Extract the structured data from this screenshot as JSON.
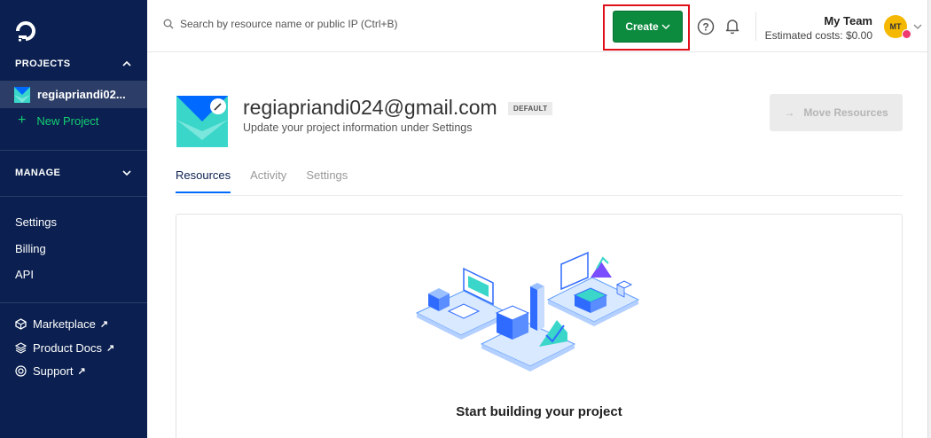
{
  "sidebar": {
    "projects_heading": "PROJECTS",
    "current_project": "regiapriandi02...",
    "new_project": "New Project",
    "manage_heading": "MANAGE",
    "nav": {
      "settings": "Settings",
      "billing": "Billing",
      "api": "API"
    },
    "external": {
      "marketplace": "Marketplace",
      "docs": "Product Docs",
      "support": "Support"
    },
    "arrow_glyph": "↗"
  },
  "topbar": {
    "search_placeholder": "Search by resource name or public IP (Ctrl+B)",
    "create_label": "Create",
    "team_name": "My Team",
    "estimated_costs": "Estimated costs: $0.00",
    "avatar_initials": "MT"
  },
  "project": {
    "title": "regiapriandi024@gmail.com",
    "badge": "DEFAULT",
    "subtitle": "Update your project information under Settings",
    "move_resources": "Move Resources"
  },
  "tabs": {
    "resources": "Resources",
    "activity": "Activity",
    "settings": "Settings"
  },
  "empty_state": {
    "title": "Start building your project"
  },
  "colors": {
    "sidebar_bg": "#0b2050",
    "accent_green": "#15cd72",
    "create_btn": "#0c8a3e",
    "highlight_box": "#e0101b",
    "active_tab": "#0069ff"
  }
}
